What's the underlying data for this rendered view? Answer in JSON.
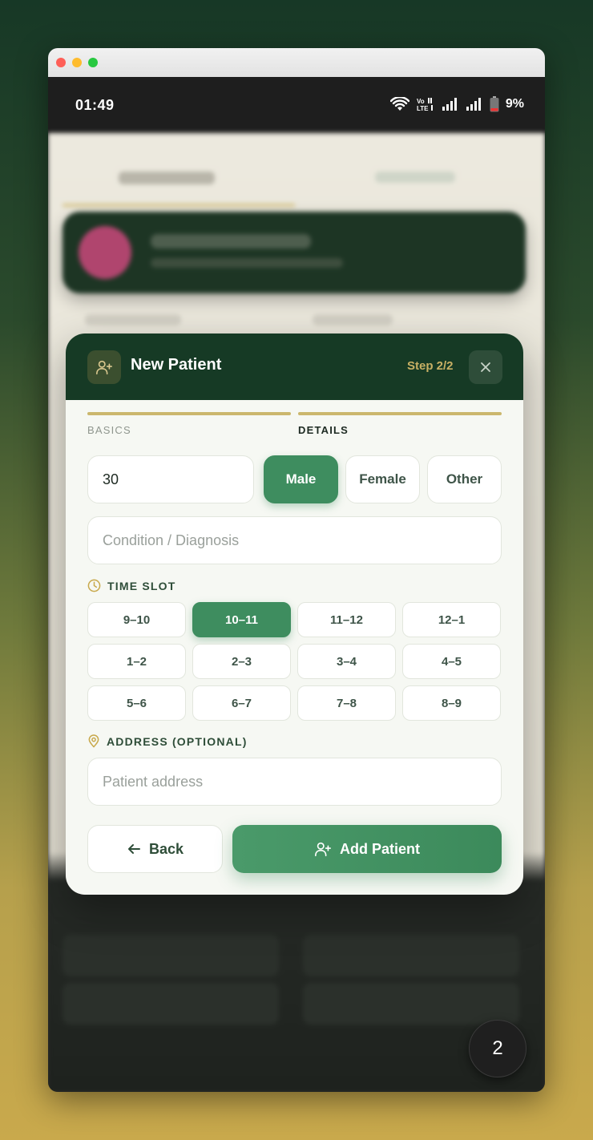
{
  "status_bar": {
    "time": "01:49",
    "battery": "9%"
  },
  "modal": {
    "title": "New Patient",
    "step": "Step 2/2",
    "steps": [
      {
        "label": "BASICS",
        "active": false
      },
      {
        "label": "DETAILS",
        "active": true
      }
    ],
    "age_value": "30",
    "gender_options": [
      "Male",
      "Female",
      "Other"
    ],
    "gender_selected": "Male",
    "condition_placeholder": "Condition / Diagnosis",
    "time_slot_title": "TIME SLOT",
    "time_slots": [
      "9–10",
      "10–11",
      "11–12",
      "12–1",
      "1–2",
      "2–3",
      "3–4",
      "4–5",
      "5–6",
      "6–7",
      "7–8",
      "8–9"
    ],
    "time_slot_selected": "10–11",
    "address_title": "ADDRESS (OPTIONAL)",
    "address_placeholder": "Patient address",
    "back_label": "Back",
    "add_label": "Add Patient"
  },
  "fab": {
    "label": "2"
  },
  "colors": {
    "header": "#163a25",
    "accent_green": "#3e8d5f",
    "gold": "#cbb76d"
  }
}
